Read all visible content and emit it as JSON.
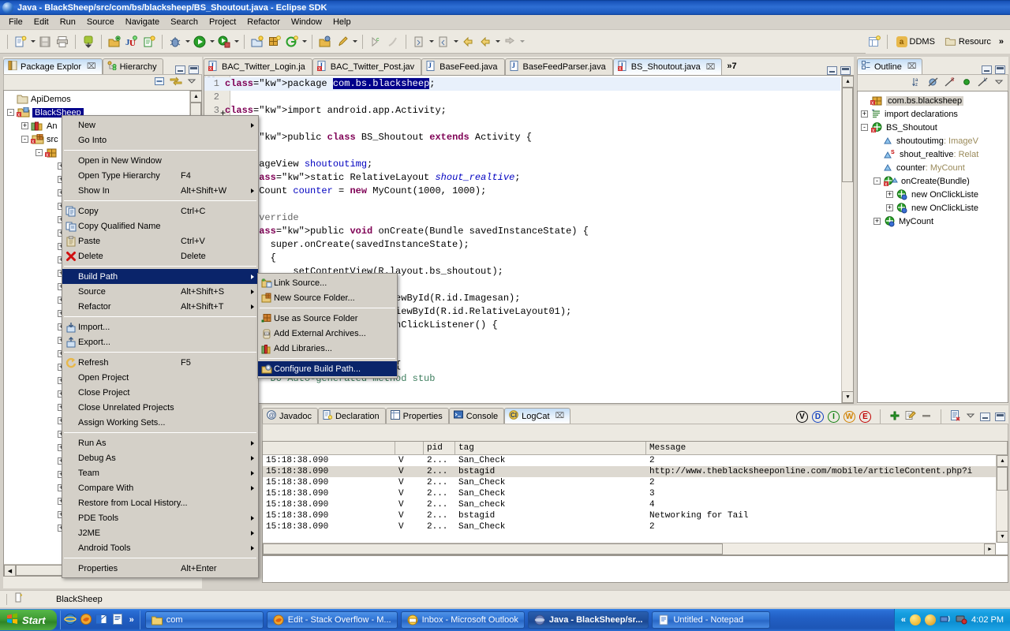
{
  "window": {
    "title": "Java - BlackSheep/src/com/bs/blacksheep/BS_Shoutout.java - Eclipse SDK",
    "icon": "eclipse-icon"
  },
  "menubar": {
    "items": [
      "File",
      "Edit",
      "Run",
      "Source",
      "Navigate",
      "Search",
      "Project",
      "Refactor",
      "Window",
      "Help"
    ]
  },
  "perspectives": {
    "items": [
      {
        "label": "DDMS",
        "icon": "ddms-icon"
      },
      {
        "label": "Resourc",
        "icon": "resource-icon"
      }
    ],
    "overflow": "»"
  },
  "package_explorer": {
    "tabs": [
      {
        "label": "Package Explor",
        "icon": "package-explorer-icon",
        "active": true,
        "close": "⌧"
      },
      {
        "label": "Hierarchy",
        "icon": "hierarchy-icon",
        "active": false
      }
    ],
    "tree": [
      {
        "label": "ApiDemos",
        "indent": 1,
        "expander": "",
        "icon": "project-closed-icon",
        "selected": false
      },
      {
        "label": "BlackSheep",
        "indent": 1,
        "expander": "-",
        "icon": "java-project-icon",
        "selected": true
      },
      {
        "label": "An",
        "indent": 2,
        "expander": "+",
        "icon": "library-icon",
        "selected": false
      },
      {
        "label": "src",
        "indent": 2,
        "expander": "-",
        "icon": "source-folder-icon",
        "selected": false
      },
      {
        "label": "",
        "indent": 3,
        "expander": "-",
        "icon": "package-icon",
        "selected": false
      }
    ],
    "hidden_child_count": 28
  },
  "editor": {
    "tabs": [
      {
        "label": "BAC_Twitter_Login.ja",
        "icon": "java-error-icon",
        "active": false
      },
      {
        "label": "BAC_Twitter_Post.jav",
        "icon": "java-error-icon",
        "active": false
      },
      {
        "label": "BaseFeed.java",
        "icon": "java-icon",
        "active": false
      },
      {
        "label": "BaseFeedParser.java",
        "icon": "java-icon",
        "active": false
      },
      {
        "label": "BS_Shoutout.java",
        "icon": "java-error-icon",
        "active": true,
        "close": "⌧"
      }
    ],
    "overflow_label": "»7",
    "lines": [
      {
        "num": "1",
        "text": "package com.bs.blacksheep;"
      },
      {
        "num": "2",
        "text": ""
      },
      {
        "num": "3",
        "text": "import android.app.Activity;"
      },
      {
        "num": "",
        "text": ""
      },
      {
        "num": "",
        "text": "public class BS_Shoutout extends Activity {"
      },
      {
        "num": "",
        "text": ""
      },
      {
        "num": "",
        "text": "    ImageView shoutoutimg;"
      },
      {
        "num": "",
        "text": "    static RelativeLayout shout_realtive;"
      },
      {
        "num": "",
        "text": "    MyCount counter = new MyCount(1000, 1000);"
      },
      {
        "num": "",
        "text": ""
      },
      {
        "num": "",
        "text": "    @Override"
      },
      {
        "num": "",
        "text": "    public void onCreate(Bundle savedInstanceState) {"
      },
      {
        "num": "",
        "text": "        super.onCreate(savedInstanceState);"
      },
      {
        "num": "",
        "text": "        {"
      },
      {
        "num": "",
        "text": "            setContentView(R.layout.bs_shoutout);"
      },
      {
        "num": "",
        "text": "            ();"
      },
      {
        "num": "",
        "text": "            (ImageView) findViewById(R.id.Imagesan);"
      },
      {
        "num": "",
        "text": "    e = (RelativeLayout) findViewById(R.id.RelativeLayout01);"
      },
      {
        "num": "",
        "text": "    e.setOnClickListener(new OnClickListener() {"
      },
      {
        "num": "",
        "text": ""
      },
      {
        "num": "",
        "text": "        e"
      },
      {
        "num": "",
        "text": "        id onClick(View arg0) {"
      },
      {
        "num": "",
        "text": "        DO Auto-generated method stub"
      }
    ],
    "highlighted_token": "com.bs.blacksheep"
  },
  "outline": {
    "tab": {
      "label": "Outline",
      "icon": "outline-icon",
      "close": "⌧"
    },
    "toolbar": [
      "sort-icon",
      "hide-fields-icon",
      "hide-static-icon",
      "hide-nonpublic-icon",
      "hide-local-icon",
      "view-menu-icon"
    ],
    "items": [
      {
        "label": "com.bs.blacksheep",
        "type": "",
        "indent": 1,
        "expander": "",
        "icon": "package-icon",
        "selected": true
      },
      {
        "label": "import declarations",
        "type": "",
        "indent": 1,
        "expander": "+",
        "icon": "imports-icon",
        "selected": false
      },
      {
        "label": "BS_Shoutout",
        "type": "",
        "indent": 1,
        "expander": "-",
        "icon": "class-error-icon",
        "selected": false
      },
      {
        "label": "shoutoutimg",
        "type": " : ImageV",
        "indent": 2,
        "expander": "",
        "icon": "field-icon",
        "selected": false
      },
      {
        "label": "shout_realtive",
        "type": " : Relat",
        "indent": 2,
        "expander": "",
        "icon": "field-static-icon",
        "selected": false
      },
      {
        "label": "counter",
        "type": " : MyCount",
        "indent": 2,
        "expander": "",
        "icon": "field-icon",
        "selected": false
      },
      {
        "label": "onCreate(Bundle)",
        "type": "",
        "indent": 2,
        "expander": "-",
        "icon": "method-error-icon",
        "selected": false
      },
      {
        "label": "new OnClickListe",
        "type": "",
        "indent": 3,
        "expander": "+",
        "icon": "anon-class-icon",
        "selected": false
      },
      {
        "label": "new OnClickListe",
        "type": "",
        "indent": 3,
        "expander": "+",
        "icon": "anon-class-icon",
        "selected": false
      },
      {
        "label": "MyCount",
        "type": "",
        "indent": 2,
        "expander": "+",
        "icon": "class-icon",
        "selected": false
      }
    ]
  },
  "bottom_panel": {
    "tabs": [
      {
        "label": "Javadoc",
        "icon": "javadoc-icon",
        "active": false
      },
      {
        "label": "Declaration",
        "icon": "declaration-icon",
        "active": false
      },
      {
        "label": "Properties",
        "icon": "properties-icon",
        "active": false
      },
      {
        "label": "Console",
        "icon": "console-icon",
        "active": false
      },
      {
        "label": "LogCat",
        "icon": "logcat-icon",
        "active": true,
        "close": "⌧"
      }
    ],
    "filters": [
      {
        "label": "V",
        "color": "#000000",
        "name": "verbose-filter"
      },
      {
        "label": "D",
        "color": "#1040c0",
        "name": "debug-filter"
      },
      {
        "label": "I",
        "color": "#108010",
        "name": "info-filter"
      },
      {
        "label": "W",
        "color": "#d08000",
        "name": "warn-filter"
      },
      {
        "label": "E",
        "color": "#c00000",
        "name": "error-filter"
      }
    ],
    "actions": [
      "add-filter-icon",
      "edit-filter-icon",
      "remove-filter-icon",
      "clear-log-icon",
      "view-menu-icon",
      "minimize-icon",
      "maximize-icon"
    ]
  },
  "logcat": {
    "columns": [
      "",
      "",
      "pid",
      "tag",
      "Message"
    ],
    "rows": [
      {
        "time": "15:18:38.090",
        "level": "V",
        "pid": "2...",
        "tag": "San_Check",
        "message": "2",
        "alt": false
      },
      {
        "time": "15:18:38.090",
        "level": "V",
        "pid": "2...",
        "tag": "bstagid",
        "message": "http://www.theblacksheeponline.com/mobile/articleContent.php?i",
        "alt": true
      },
      {
        "time": "15:18:38.090",
        "level": "V",
        "pid": "2...",
        "tag": "San_Check",
        "message": "2",
        "alt": false
      },
      {
        "time": "15:18:38.090",
        "level": "V",
        "pid": "2...",
        "tag": "San_Check",
        "message": "3",
        "alt": false
      },
      {
        "time": "15:18:38.090",
        "level": "V",
        "pid": "2...",
        "tag": "San_check",
        "message": "4",
        "alt": false
      },
      {
        "time": "15:18:38.090",
        "level": "V",
        "pid": "2...",
        "tag": "bstagid",
        "message": "Networking for Tail",
        "alt": false
      },
      {
        "time": "15:18:38.090",
        "level": "V",
        "pid": "2...",
        "tag": "San_Check",
        "message": "2",
        "alt": false
      }
    ]
  },
  "context_menu": {
    "items": [
      {
        "label": "New",
        "accel": "",
        "submenu": true,
        "icon": "",
        "sep_after": false
      },
      {
        "label": "Go Into",
        "accel": "",
        "submenu": false,
        "icon": "",
        "sep_after": true
      },
      {
        "label": "Open in New Window",
        "accel": "",
        "submenu": false,
        "icon": "",
        "sep_after": false
      },
      {
        "label": "Open Type Hierarchy",
        "accel": "F4",
        "submenu": false,
        "icon": "",
        "sep_after": false
      },
      {
        "label": "Show In",
        "accel": "Alt+Shift+W",
        "submenu": true,
        "icon": "",
        "sep_after": true
      },
      {
        "label": "Copy",
        "accel": "Ctrl+C",
        "submenu": false,
        "icon": "copy-icon",
        "sep_after": false
      },
      {
        "label": "Copy Qualified Name",
        "accel": "",
        "submenu": false,
        "icon": "copy-qualified-icon",
        "sep_after": false
      },
      {
        "label": "Paste",
        "accel": "Ctrl+V",
        "submenu": false,
        "icon": "paste-icon",
        "sep_after": false
      },
      {
        "label": "Delete",
        "accel": "Delete",
        "submenu": false,
        "icon": "delete-icon",
        "sep_after": true
      },
      {
        "label": "Build Path",
        "accel": "",
        "submenu": true,
        "icon": "",
        "sep_after": false,
        "highlighted": true
      },
      {
        "label": "Source",
        "accel": "Alt+Shift+S",
        "submenu": true,
        "icon": "",
        "sep_after": false
      },
      {
        "label": "Refactor",
        "accel": "Alt+Shift+T",
        "submenu": true,
        "icon": "",
        "sep_after": true
      },
      {
        "label": "Import...",
        "accel": "",
        "submenu": false,
        "icon": "import-icon",
        "sep_after": false
      },
      {
        "label": "Export...",
        "accel": "",
        "submenu": false,
        "icon": "export-icon",
        "sep_after": true
      },
      {
        "label": "Refresh",
        "accel": "F5",
        "submenu": false,
        "icon": "refresh-icon",
        "sep_after": false
      },
      {
        "label": "Open Project",
        "accel": "",
        "submenu": false,
        "icon": "",
        "sep_after": false
      },
      {
        "label": "Close Project",
        "accel": "",
        "submenu": false,
        "icon": "",
        "sep_after": false
      },
      {
        "label": "Close Unrelated Projects",
        "accel": "",
        "submenu": false,
        "icon": "",
        "sep_after": false
      },
      {
        "label": "Assign Working Sets...",
        "accel": "",
        "submenu": false,
        "icon": "",
        "sep_after": true
      },
      {
        "label": "Run As",
        "accel": "",
        "submenu": true,
        "icon": "",
        "sep_after": false
      },
      {
        "label": "Debug As",
        "accel": "",
        "submenu": true,
        "icon": "",
        "sep_after": false
      },
      {
        "label": "Team",
        "accel": "",
        "submenu": true,
        "icon": "",
        "sep_after": false
      },
      {
        "label": "Compare With",
        "accel": "",
        "submenu": true,
        "icon": "",
        "sep_after": false
      },
      {
        "label": "Restore from Local History...",
        "accel": "",
        "submenu": false,
        "icon": "",
        "sep_after": false
      },
      {
        "label": "PDE Tools",
        "accel": "",
        "submenu": true,
        "icon": "",
        "sep_after": false
      },
      {
        "label": "J2ME",
        "accel": "",
        "submenu": true,
        "icon": "",
        "sep_after": false
      },
      {
        "label": "Android Tools",
        "accel": "",
        "submenu": true,
        "icon": "",
        "sep_after": true
      },
      {
        "label": "Properties",
        "accel": "Alt+Enter",
        "submenu": false,
        "icon": "",
        "sep_after": false
      }
    ]
  },
  "build_path_submenu": {
    "items": [
      {
        "label": "Link Source...",
        "icon": "link-source-icon",
        "sep_after": false
      },
      {
        "label": "New Source Folder...",
        "icon": "new-source-folder-icon",
        "sep_after": true
      },
      {
        "label": "Use as Source Folder",
        "icon": "use-as-source-icon",
        "sep_after": false
      },
      {
        "label": "Add External Archives...",
        "icon": "add-archives-icon",
        "sep_after": false
      },
      {
        "label": "Add Libraries...",
        "icon": "add-libraries-icon",
        "sep_after": true
      },
      {
        "label": "Configure Build Path...",
        "icon": "configure-build-path-icon",
        "sep_after": false,
        "highlighted": true
      }
    ]
  },
  "statusbar": {
    "icon": "project-icon",
    "text": "BlackSheep"
  },
  "taskbar": {
    "start_label": "Start",
    "quicklaunch": [
      "ie-icon",
      "firefox-icon",
      "outlook-icon",
      "notepad-icon"
    ],
    "quicklaunch_overflow": "»",
    "tasks": [
      {
        "label": "com",
        "icon": "folder-icon",
        "active": false
      },
      {
        "label": "Edit - Stack Overflow - M...",
        "icon": "firefox-icon",
        "active": false
      },
      {
        "label": "Inbox - Microsoft Outlook",
        "icon": "outlook-icon",
        "active": false
      },
      {
        "label": "Java - BlackSheep/sr...",
        "icon": "eclipse-icon",
        "active": true
      },
      {
        "label": "Untitled - Notepad",
        "icon": "notepad-icon",
        "active": false
      }
    ],
    "tray": {
      "expander": "«",
      "icons": [
        "smiley-icon",
        "outlook-tray-icon",
        "network-icon",
        "volume-icon"
      ],
      "clock": "4:02 PM"
    }
  },
  "colors": {
    "title_blue": "#1752b8",
    "menu_highlight": "#0a246a",
    "selection_blue": "#00008b",
    "panel_bg": "#ece9e1",
    "menu_bg": "#d4d0c8"
  }
}
